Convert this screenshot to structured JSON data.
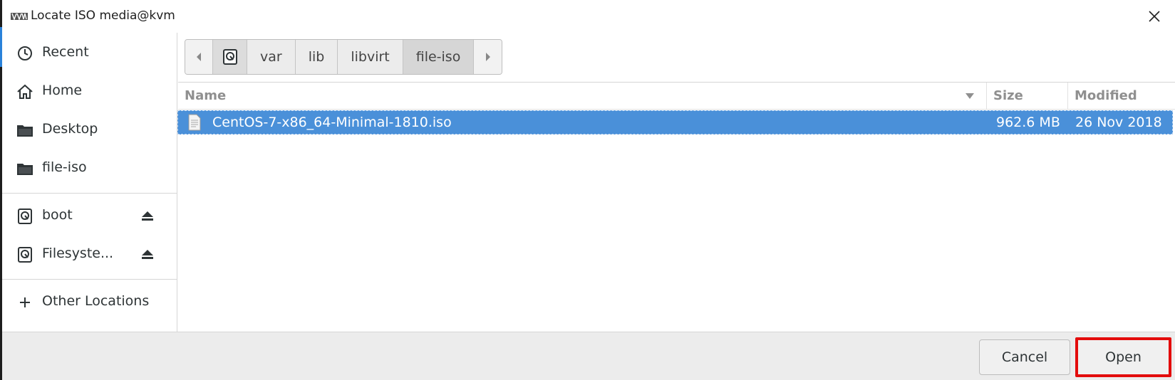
{
  "window": {
    "title": "Locate ISO media@kvm"
  },
  "sidebar": {
    "places": [
      {
        "label": "Recent",
        "icon": "clock-icon"
      },
      {
        "label": "Home",
        "icon": "home-icon"
      },
      {
        "label": "Desktop",
        "icon": "folder-icon"
      },
      {
        "label": "file-iso",
        "icon": "folder-icon"
      }
    ],
    "devices": [
      {
        "label": "boot",
        "icon": "drive-icon"
      },
      {
        "label": "Filesyste...",
        "icon": "drive-icon"
      }
    ],
    "other_locations": {
      "label": "Other Locations",
      "icon": "plus-icon"
    }
  },
  "pathbar": {
    "segments": [
      "var",
      "lib",
      "libvirt",
      "file-iso"
    ],
    "active": "file-iso"
  },
  "file_list": {
    "columns": {
      "name": "Name",
      "size": "Size",
      "modified": "Modified"
    },
    "rows": [
      {
        "name": "CentOS-7-x86_64-Minimal-1810.iso",
        "size": "962.6 MB",
        "modified": "26 Nov 2018",
        "selected": true
      }
    ]
  },
  "buttons": {
    "cancel": "Cancel",
    "open": "Open"
  },
  "colors": {
    "selection": "#4a90d9",
    "highlight_box": "#e30c0c"
  }
}
